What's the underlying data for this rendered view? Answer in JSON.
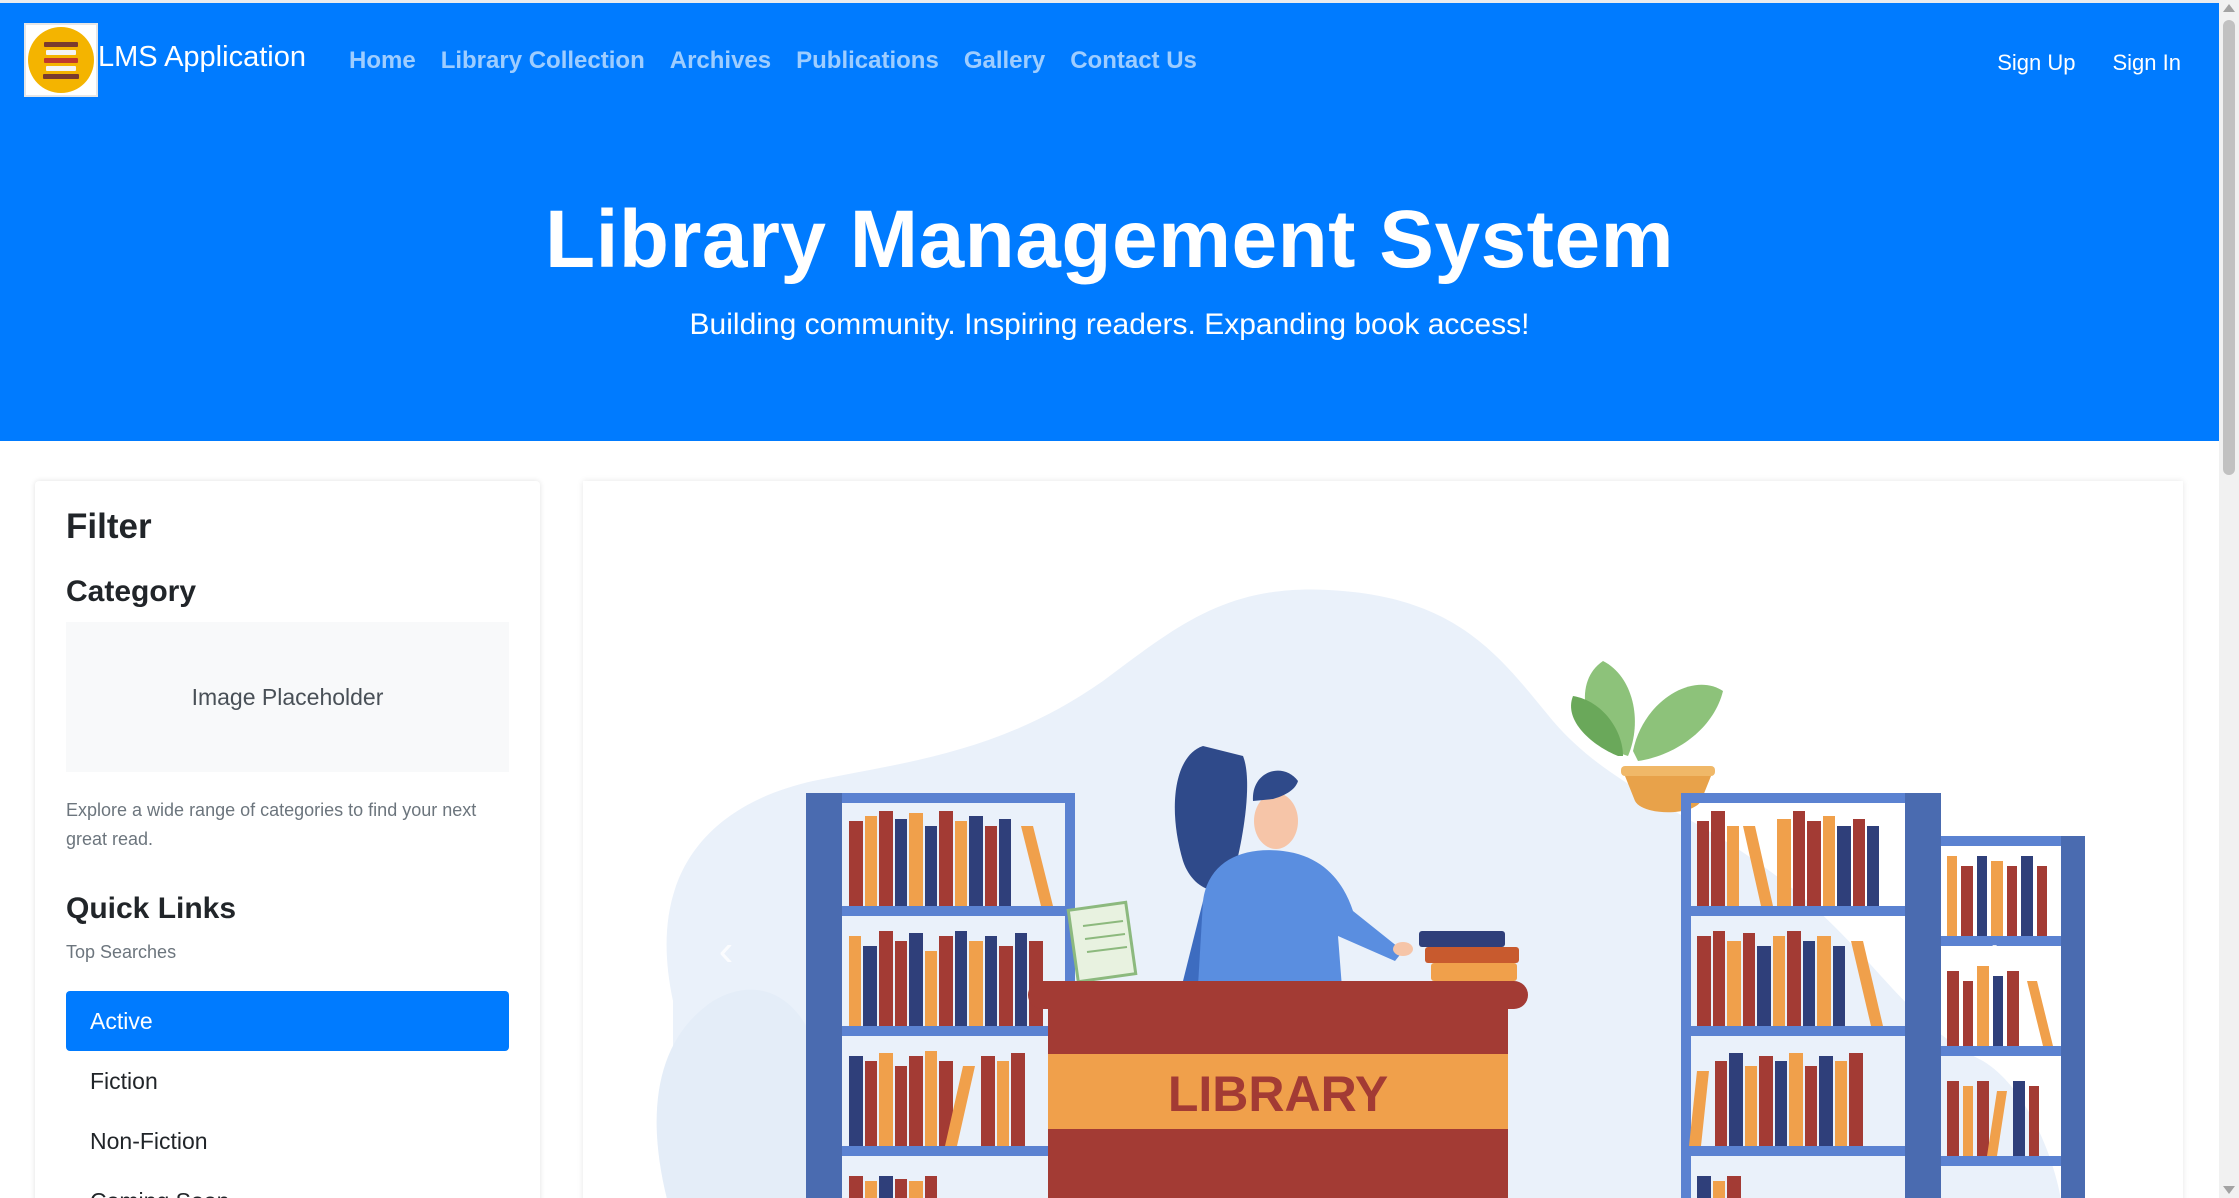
{
  "header": {
    "brand": "LMS Application",
    "nav": [
      {
        "label": "Home"
      },
      {
        "label": "Library Collection"
      },
      {
        "label": "Archives"
      },
      {
        "label": "Publications"
      },
      {
        "label": "Gallery"
      },
      {
        "label": "Contact Us"
      }
    ],
    "auth": {
      "sign_up": "Sign Up",
      "sign_in": "Sign In"
    }
  },
  "hero": {
    "title": "Library Management System",
    "subtitle": "Building community. Inspiring readers. Expanding book access!"
  },
  "sidebar": {
    "filter_title": "Filter",
    "category_title": "Category",
    "placeholder": "Image Placeholder",
    "description": "Explore a wide range of categories to find your next great read.",
    "quick_links_title": "Quick Links",
    "top_searches": "Top Searches",
    "items": [
      {
        "label": "Active",
        "active": true
      },
      {
        "label": "Fiction",
        "active": false
      },
      {
        "label": "Non-Fiction",
        "active": false
      },
      {
        "label": "Coming Soon",
        "active": false
      }
    ]
  },
  "carousel": {
    "sign_text": "LIBRARY",
    "prev_icon": "chevron-left-icon",
    "next_icon": "chevron-right-icon"
  },
  "colors": {
    "primary": "#007bff",
    "book_orange": "#f0a04b",
    "book_red": "#a33b34",
    "book_navy": "#2f3f7a",
    "shelf_blue": "#4a6bb0"
  }
}
